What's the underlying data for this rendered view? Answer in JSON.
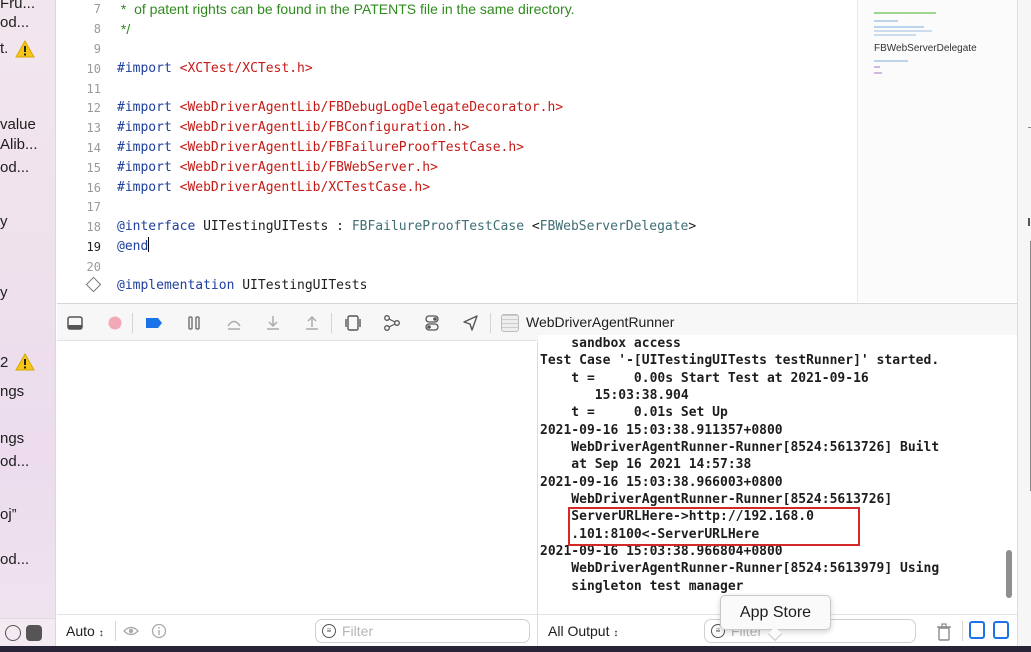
{
  "sidebar": {
    "fragments": [
      "Fru...",
      "od...",
      "t.",
      "value",
      "Alib...",
      "od...",
      "y",
      "y",
      "2",
      "ngs",
      "ngs",
      "od...",
      "oj”",
      "od..."
    ]
  },
  "editor": {
    "lines": [
      {
        "num": "7",
        "text": " *  of patent rights can be found in the PATENTS file in the same directory."
      },
      {
        "num": "8",
        "text": " */"
      },
      {
        "num": "9",
        "text": ""
      },
      {
        "num": "10",
        "directive": "#import",
        "path": "<XCTest/XCTest.h>"
      },
      {
        "num": "11",
        "text": ""
      },
      {
        "num": "12",
        "directive": "#import",
        "path": "<WebDriverAgentLib/FBDebugLogDelegateDecorator.h>"
      },
      {
        "num": "13",
        "directive": "#import",
        "path": "<WebDriverAgentLib/FBConfiguration.h>"
      },
      {
        "num": "14",
        "directive": "#import",
        "path": "<WebDriverAgentLib/FBFailureProofTestCase.h>"
      },
      {
        "num": "15",
        "directive": "#import",
        "path": "<WebDriverAgentLib/FBWebServer.h>"
      },
      {
        "num": "16",
        "directive": "#import",
        "path": "<WebDriverAgentLib/XCTestCase.h>"
      },
      {
        "num": "17",
        "text": ""
      },
      {
        "num": "18",
        "interface_kw": "@interface",
        "class_name": "UITestingUITests",
        "colon": " : ",
        "super": "FBFailureProofTestCase",
        "proto_open": " <",
        "protocol": "FBWebServerDelegate",
        "proto_close": ">"
      },
      {
        "num": "19",
        "end_kw": "@end"
      },
      {
        "num": "20",
        "text": ""
      },
      {
        "num": "",
        "impl_kw": "@implementation",
        "impl_name": "UITestingUITests"
      }
    ]
  },
  "minimap": {
    "symbol": "FBWebServerDelegate"
  },
  "debug_toolbar": {
    "target": "WebDriverAgentRunner"
  },
  "console": {
    "lines": [
      "    sandbox access",
      "Test Case '-[UITestingUITests testRunner]' started.",
      "    t =     0.00s Start Test at 2021-09-16",
      "       15:03:38.904",
      "    t =     0.01s Set Up",
      "2021-09-16 15:03:38.911357+0800",
      "    WebDriverAgentRunner-Runner[8524:5613726] Built",
      "    at Sep 16 2021 14:57:38",
      "2021-09-16 15:03:38.966003+0800",
      "    WebDriverAgentRunner-Runner[8524:5613726]",
      "    ServerURLHere->http://192.168.0",
      "    .101:8100<-ServerURLHere",
      "2021-09-16 15:03:38.966804+0800",
      "    WebDriverAgentRunner-Runner[8524:5613979] Using",
      "    singleton test manager"
    ]
  },
  "vars_footer": {
    "scope": "Auto",
    "filter_placeholder": "Filter"
  },
  "console_footer": {
    "output": "All Output",
    "filter_placeholder": "Filter"
  },
  "tooltip": {
    "text": "App Store"
  },
  "colors": {
    "keyword": "#9b2393",
    "string": "#c41a16",
    "comment": "#2f8a1e",
    "class": "#3f6e74",
    "highlight": "#d62828",
    "accent": "#1a73e8"
  }
}
